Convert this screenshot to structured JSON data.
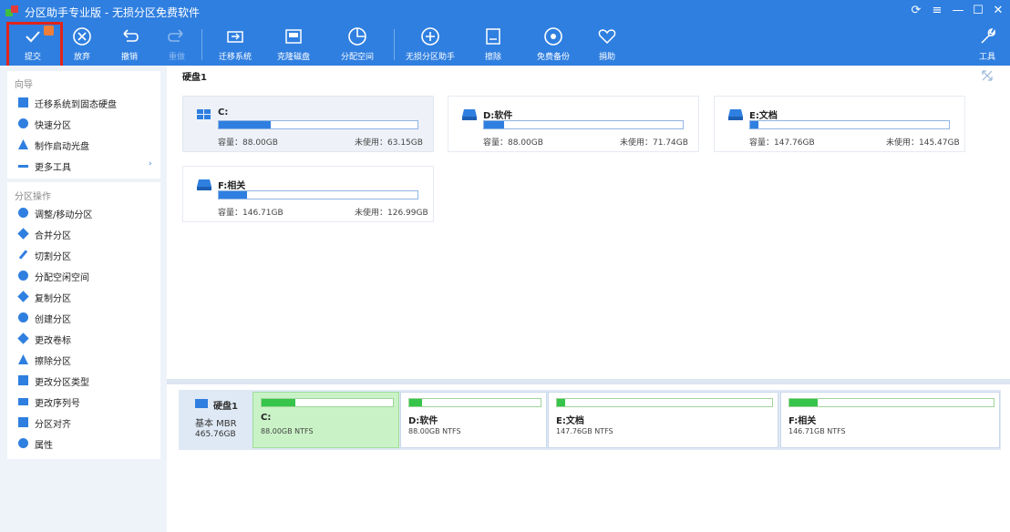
{
  "window": {
    "title": "分区助手专业版 - 无损分区免费软件",
    "controls": [
      "refresh-icon",
      "menu-icon",
      "minimize-icon",
      "maximize-icon",
      "close-icon"
    ]
  },
  "toolbar": {
    "commit": "提交",
    "discard": "放弃",
    "undo": "撤销",
    "redo": "重做",
    "migrate": "迁移系统",
    "clone_disk": "克隆磁盘",
    "allocate_space": "分配空间",
    "free_partition": "无损分区助手",
    "wipe": "擦除",
    "free_backup": "免费备份",
    "donate": "捐助",
    "tools": "工具"
  },
  "sidebar": {
    "wizard_head": "向导",
    "wizard_items": [
      {
        "label": "迁移系统到固态硬盘",
        "icon": "migrate-icon"
      },
      {
        "label": "快速分区",
        "icon": "quick-partition-icon"
      },
      {
        "label": "制作启动光盘",
        "icon": "bootable-disc-icon"
      },
      {
        "label": "更多工具",
        "icon": "more-tools-icon",
        "arrow": "›"
      }
    ],
    "ops_head": "分区操作",
    "ops_items": [
      {
        "label": "调整/移动分区",
        "icon": "resize-icon"
      },
      {
        "label": "合并分区",
        "icon": "merge-icon"
      },
      {
        "label": "切割分区",
        "icon": "split-icon"
      },
      {
        "label": "分配空闲空间",
        "icon": "allocate-icon"
      },
      {
        "label": "复制分区",
        "icon": "copy-icon"
      },
      {
        "label": "创建分区",
        "icon": "create-icon"
      },
      {
        "label": "更改卷标",
        "icon": "label-icon"
      },
      {
        "label": "擦除分区",
        "icon": "wipe-icon"
      },
      {
        "label": "更改分区类型",
        "icon": "type-icon"
      },
      {
        "label": "更改序列号",
        "icon": "serial-icon"
      },
      {
        "label": "分区对齐",
        "icon": "align-icon"
      },
      {
        "label": "属性",
        "icon": "info-icon"
      }
    ]
  },
  "main": {
    "disk_title": "硬盘1",
    "partitions": [
      {
        "name": "C:",
        "capacity": "容量：88.00GB",
        "free": "未使用：63.15GB",
        "used_fraction": 0.26,
        "selected": true
      },
      {
        "name": "D:软件",
        "capacity": "容量：88.00GB",
        "free": "未使用：71.74GB",
        "used_fraction": 0.1,
        "selected": false
      },
      {
        "name": "E:文档",
        "capacity": "容量：147.76GB",
        "free": "未使用：145.47GB",
        "used_fraction": 0.04,
        "selected": false
      },
      {
        "name": "F:相关",
        "capacity": "容量：146.71GB",
        "free": "未使用：126.99GB",
        "used_fraction": 0.14,
        "selected": false
      }
    ]
  },
  "diskmap": {
    "disk_name": "硬盘1",
    "disk_type": "基本 MBR",
    "disk_size": "465.76GB",
    "partitions": [
      {
        "name": "C:",
        "size": "88.00GB NTFS",
        "used_fraction": 0.26,
        "selected": true
      },
      {
        "name": "D:软件",
        "size": "88.00GB NTFS",
        "used_fraction": 0.1,
        "selected": false
      },
      {
        "name": "E:文档",
        "size": "147.76GB NTFS",
        "used_fraction": 0.04,
        "selected": false
      },
      {
        "name": "F:相关",
        "size": "146.71GB NTFS",
        "used_fraction": 0.14,
        "selected": false
      }
    ]
  },
  "colors": {
    "accent": "#2f7fe0",
    "highlight_box": "#e2241b",
    "usage_green": "#36c44a",
    "selected_green_bg": "#c9f2c6"
  }
}
